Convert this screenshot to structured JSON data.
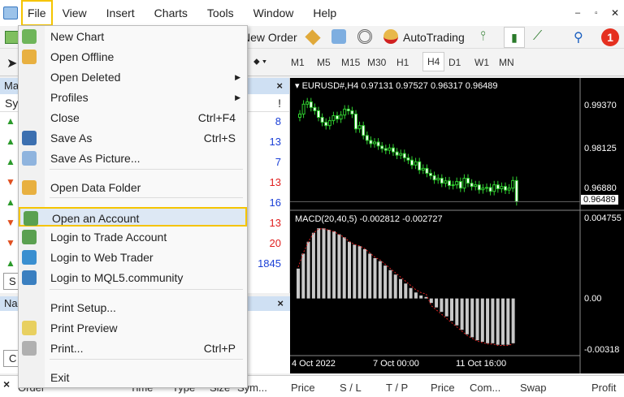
{
  "menubar": [
    "File",
    "View",
    "Insert",
    "Charts",
    "Tools",
    "Window",
    "Help"
  ],
  "toolbar": {
    "new_order": "New Order",
    "autotrading": "AutoTrading",
    "notifications": "1"
  },
  "timeframes": [
    "M1",
    "M5",
    "M15",
    "M30",
    "H1",
    "H4",
    "D1",
    "W1",
    "MN"
  ],
  "selected_timeframe": "H4",
  "market_watch": {
    "title": "Ma",
    "col": "Sy",
    "excl": "!",
    "rows": [
      {
        "dir": "up",
        "value": "8",
        "color": "#1a3fd6"
      },
      {
        "dir": "up",
        "value": "13",
        "color": "#1a3fd6"
      },
      {
        "dir": "up",
        "value": "7",
        "color": "#1a3fd6"
      },
      {
        "dir": "down",
        "value": "13",
        "color": "#e02020"
      },
      {
        "dir": "up",
        "value": "16",
        "color": "#1a3fd6"
      },
      {
        "dir": "down",
        "value": "13",
        "color": "#e02020"
      },
      {
        "dir": "down",
        "value": "20",
        "color": "#e02020"
      },
      {
        "dir": "up",
        "value": "1845",
        "color": "#1a3fd6"
      }
    ],
    "tab": "S"
  },
  "navigator": {
    "title": "Na",
    "tab": "C"
  },
  "chart": {
    "header": "EURUSD#,H4  0.97131 0.97527 0.96317 0.96489",
    "price_labels": [
      "0.99370",
      "0.98125",
      "0.96880"
    ],
    "current_price": "0.96489",
    "macd_header": "MACD(20,40,5) -0.002812 -0.002727",
    "macd_labels": [
      "0.004755",
      "0.00",
      "-0.00318"
    ],
    "time_labels": [
      "4 Oct 2022",
      "7 Oct 00:00",
      "11 Oct 16:00"
    ]
  },
  "file_menu": [
    {
      "label": "New Chart",
      "icon": "new-chart"
    },
    {
      "label": "Open Offline",
      "icon": "folder"
    },
    {
      "label": "Open Deleted",
      "submenu": true
    },
    {
      "label": "Profiles",
      "submenu": true
    },
    {
      "label": "Close",
      "shortcut": "Ctrl+F4"
    },
    {
      "label": "Save As",
      "shortcut": "Ctrl+S",
      "icon": "save"
    },
    {
      "label": "Save As Picture...",
      "icon": "picture"
    },
    {
      "label": "Open Data Folder",
      "icon": "folder"
    },
    {
      "label": "Open an Account",
      "icon": "user-add",
      "highlighted": true
    },
    {
      "label": "Login to Trade Account",
      "icon": "user"
    },
    {
      "label": "Login to Web Trader",
      "icon": "globe"
    },
    {
      "label": "Login to MQL5.community",
      "icon": "mql5"
    },
    {
      "label": "Print Setup..."
    },
    {
      "label": "Print Preview",
      "icon": "print-preview"
    },
    {
      "label": "Print...",
      "shortcut": "Ctrl+P",
      "icon": "printer"
    },
    {
      "label": "Exit"
    }
  ],
  "terminal_headers": [
    "Order",
    "Time",
    "Type",
    "Size",
    "Sym...",
    "Price",
    "S / L",
    "T / P",
    "Price",
    "Com...",
    "Swap",
    "Profit"
  ],
  "chart_data": {
    "type": "candlestick",
    "closes": [
      0.9915,
      0.9945,
      0.9952,
      0.9935,
      0.9925,
      0.9905,
      0.989,
      0.988,
      0.9895,
      0.991,
      0.99,
      0.9912,
      0.993,
      0.9925,
      0.9915,
      0.987,
      0.988,
      0.985,
      0.9835,
      0.9825,
      0.983,
      0.9818,
      0.981,
      0.9805,
      0.9812,
      0.98,
      0.979,
      0.9795,
      0.9782,
      0.9775,
      0.976,
      0.977,
      0.9745,
      0.975,
      0.9735,
      0.9728,
      0.9715,
      0.972,
      0.9705,
      0.9712,
      0.9698,
      0.97,
      0.971,
      0.969,
      0.972,
      0.9705,
      0.9695,
      0.97,
      0.9685,
      0.969,
      0.9692,
      0.968,
      0.97,
      0.9688,
      0.9695,
      0.9684,
      0.969,
      0.9713,
      0.9649
    ],
    "ylim": [
      0.9635,
      1.0005
    ],
    "macd": [
      0.002,
      0.003,
      0.0038,
      0.0044,
      0.0047,
      0.0047,
      0.0046,
      0.0045,
      0.0043,
      0.0041,
      0.0038,
      0.0036,
      0.0035,
      0.0033,
      0.003,
      0.0027,
      0.0025,
      0.0022,
      0.0019,
      0.0016,
      0.0013,
      0.001,
      0.0007,
      0.0004,
      0.0002,
      0.0001,
      -0.0003,
      -0.0006,
      -0.0009,
      -0.0012,
      -0.0015,
      -0.0018,
      -0.0021,
      -0.0024,
      -0.0026,
      -0.0028,
      -0.0029,
      -0.003,
      -0.003,
      -0.0031,
      -0.0031,
      -0.0031,
      -0.003
    ],
    "macd_ylim": [
      -0.0035,
      0.0052
    ]
  }
}
